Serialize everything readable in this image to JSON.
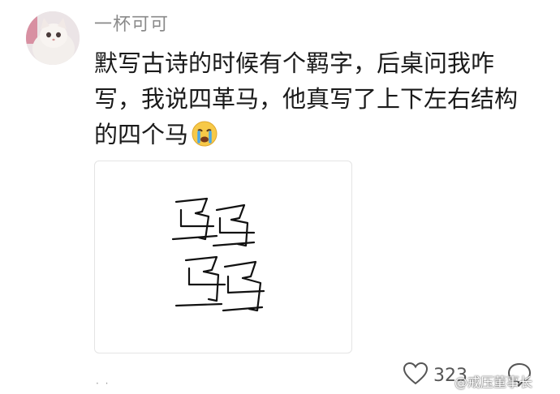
{
  "post": {
    "username": "一杯可可",
    "text_lines": [
      "默写古诗的时候有个羁字，后桌问我咋",
      "写，我说四革马，他真写了上下左右结构",
      "的四个马"
    ],
    "emoji": "crying-face-emoji"
  },
  "actions": {
    "like_count": "323",
    "like_icon": "heart-icon",
    "comment_icon": "comment-bubble-icon"
  },
  "watermark": "@戒压董事长",
  "colors": {
    "text": "#1a1a1a",
    "username": "#8a8a8a",
    "icon": "#555555",
    "emoji_face": "#f7c948"
  }
}
